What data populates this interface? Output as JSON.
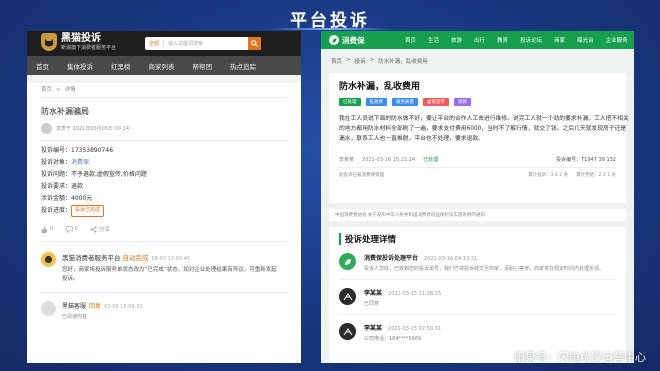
{
  "page": {
    "title": "平台投诉",
    "watermark": "雨果号：闪电优家运营中心"
  },
  "colors": {
    "background": "#17306e",
    "heimao_accent": "#e2761c",
    "xfb_green": "#16a04e"
  },
  "heimao": {
    "logo_main": "黑猫投诉",
    "logo_sub": "新浪旗下消费者服务平台",
    "search": {
      "select": "全部",
      "placeholder": "输入关键词搜索",
      "icon": "search-icon"
    },
    "nav": [
      "首页",
      "集体投诉",
      "红黑榜",
      "商家列表",
      "帮帮团",
      "热点追踪"
    ],
    "crumb": [
      "首页",
      ">",
      "详情"
    ],
    "title": "防水补漏骗局",
    "user_line": "发表于 2021年05月05日 00:14",
    "fields": [
      {
        "k": "投诉编号：",
        "v": "17353890746",
        "style": ""
      },
      {
        "k": "投诉对象：",
        "v": "消费保",
        "style": "blue"
      },
      {
        "k": "投诉问题：",
        "v": "不予退款,虚假宣传,价格问题",
        "style": ""
      },
      {
        "k": "投诉要求：",
        "v": "退款",
        "style": ""
      },
      {
        "k": "涉诉金额：",
        "v": "4000元",
        "style": ""
      },
      {
        "k": "投诉进度：",
        "v": "投诉已完成",
        "style": "tag"
      }
    ],
    "actions": [
      "0",
      "0",
      "分享"
    ],
    "reply1": {
      "name": "黑猫消费者服务平台",
      "status": "自动完成",
      "time": "08-07 17:00:45",
      "text": "您好，商家将投诉服务单状态改为“已完成”状态，如对企业处理结果有异议，可重新发起投诉。"
    },
    "reply2": {
      "name": "黑猫客服",
      "status": "回复",
      "time": "07-08 16:09:32",
      "text": "已阅读内容"
    }
  },
  "xfb": {
    "logo": "消费保",
    "nav": [
      "首页",
      "生活",
      "旅游",
      "出行",
      "教育",
      "投诉论坛",
      "商家",
      "曝光台",
      "企业服务"
    ],
    "crumb": [
      "首页",
      ">",
      "投诉",
      ">",
      "防水补漏，乱收费用"
    ],
    "title": "防水补漏，乱收费用",
    "tags": [
      {
        "label": "已处理",
        "color": "#16a04e"
      },
      {
        "label": "乱收费",
        "color": "#3b8cf0"
      },
      {
        "label": "服务质量",
        "color": "#3b8cf0"
      },
      {
        "label": "虚假宣传",
        "color": "#f05a5a"
      },
      {
        "label": "退款",
        "color": "#9b6cf0"
      }
    ],
    "desc": "我在工人员说下面的防水做不好，要让平台的合作人工去进行维修。说完工人就一个劲的要求补漏。工人把不相关的地方都用防水材料全部刷了一遍，要求支付费用6000，当时不了解行情，就交了钱。之后几天就发现房子还是漏水，联系工人也一直推脱，平台也不处理，要求退款。",
    "meta": {
      "user": "李某某",
      "time": "2021-03-16 15:23:14",
      "status": "已处理",
      "id": "投诉编号：T1947 39 132"
    },
    "footer_left": "此投诉已被消费保受理",
    "footer_right": [
      "累计投诉：3 4 2 条",
      "累计完结：2 3 1 条"
    ],
    "banner": "中国消费者协会 关于发布中华人民共和国消费者权益保护法实施条例的通知",
    "section_title": "投诉处理详情",
    "items": [
      {
        "name": "消费保投诉处理平台",
        "time": "2021-03-16 09:13:31",
        "text": "投诉人您好，已收到您的投诉单号，我们已将投诉转交至商家，请耐心等待，商家将在规定时间内处理反馈。",
        "avatar": "green"
      },
      {
        "name": "李某某",
        "time": "2021-03-15 11:28:15",
        "text": "已同意",
        "avatar": "dark"
      },
      {
        "name": "李某某",
        "time": "2021-03-15 07:50:31",
        "text": "公司电话：184****5669",
        "avatar": "dark"
      }
    ]
  }
}
